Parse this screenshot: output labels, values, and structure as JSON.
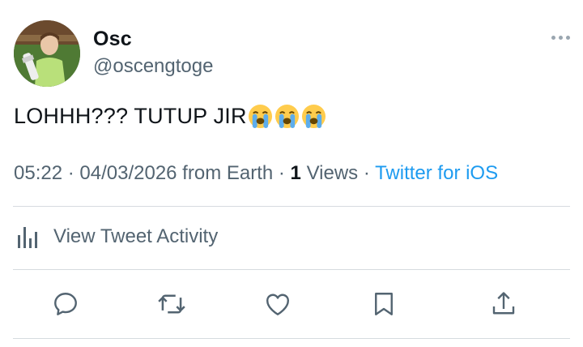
{
  "user": {
    "display_name": "Osc",
    "handle": "@oscengtoge",
    "avatar_icon": "profile-photo"
  },
  "tweet": {
    "text": "LOHHH??? TUTUP JIR",
    "emojis": [
      "loudly-crying-face",
      "loudly-crying-face",
      "loudly-crying-face"
    ]
  },
  "meta": {
    "time": "05:22",
    "sep1": " · ",
    "date": "04/03/2026",
    "location": " from Earth",
    "sep2": " · ",
    "views_count": "1",
    "views_label": " Views",
    "sep3": " · ",
    "source": "Twitter for iOS"
  },
  "activity": {
    "label": "View Tweet Activity"
  },
  "actions": [
    "reply-icon",
    "retweet-icon",
    "like-icon",
    "bookmark-icon",
    "share-icon"
  ],
  "colors": {
    "text": "#0f1419",
    "secondary": "#536471",
    "link": "#1d9bf0",
    "divider": "#d6dbdf"
  }
}
